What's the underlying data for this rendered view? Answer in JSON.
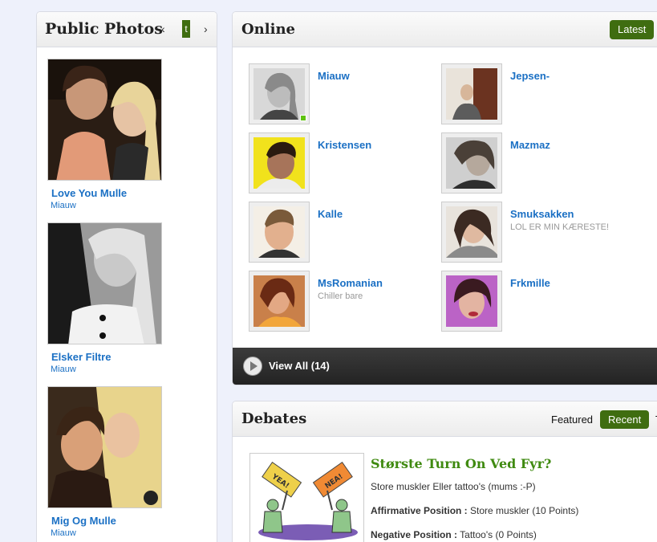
{
  "public_photos": {
    "title": "Public Photos",
    "prev_label": "‹",
    "next_label": "›",
    "active_tab_label": "t",
    "items": [
      {
        "title": "Love You Mulle",
        "author": "Miauw"
      },
      {
        "title": "Elsker Filtre",
        "author": "Miauw"
      },
      {
        "title": "Mig Og Mulle",
        "author": "Miauw"
      }
    ]
  },
  "online": {
    "title": "Online",
    "latest_label": "Latest",
    "users": [
      {
        "name": "Miauw",
        "status": "",
        "online": true
      },
      {
        "name": "Jepsen-",
        "status": "",
        "online": false
      },
      {
        "name": "Kristensen",
        "status": "",
        "online": false
      },
      {
        "name": "Mazmaz",
        "status": "",
        "online": false
      },
      {
        "name": "Kalle",
        "status": "",
        "online": false
      },
      {
        "name": "Smuksakken",
        "status": "LOL ER MIN KÆRESTE!",
        "online": false
      },
      {
        "name": "MsRomanian",
        "status": "Chiller bare",
        "online": false
      },
      {
        "name": "Frkmille",
        "status": "",
        "online": false
      }
    ],
    "view_all_label": "View All (14)"
  },
  "debates": {
    "title": "Debates",
    "tabs": {
      "featured": "Featured",
      "recent": "Recent",
      "more": "T"
    },
    "item": {
      "title": "Største Turn On Ved Fyr?",
      "description": "Store muskler Eller tattoo's (mums :-P)",
      "affirmative_label": "Affirmative Position :",
      "affirmative_value": "Store muskler (10 Points)",
      "negative_label": "Negative Position :",
      "negative_value": "Tattoo's (0 Points)",
      "sign_yes": "YEA!",
      "sign_no": "NEA!"
    }
  },
  "colors": {
    "accent_green": "#3f6d10",
    "link_blue": "#1b70c4",
    "debate_title_green": "#3f8a10",
    "online_dot": "#5ec20f"
  }
}
